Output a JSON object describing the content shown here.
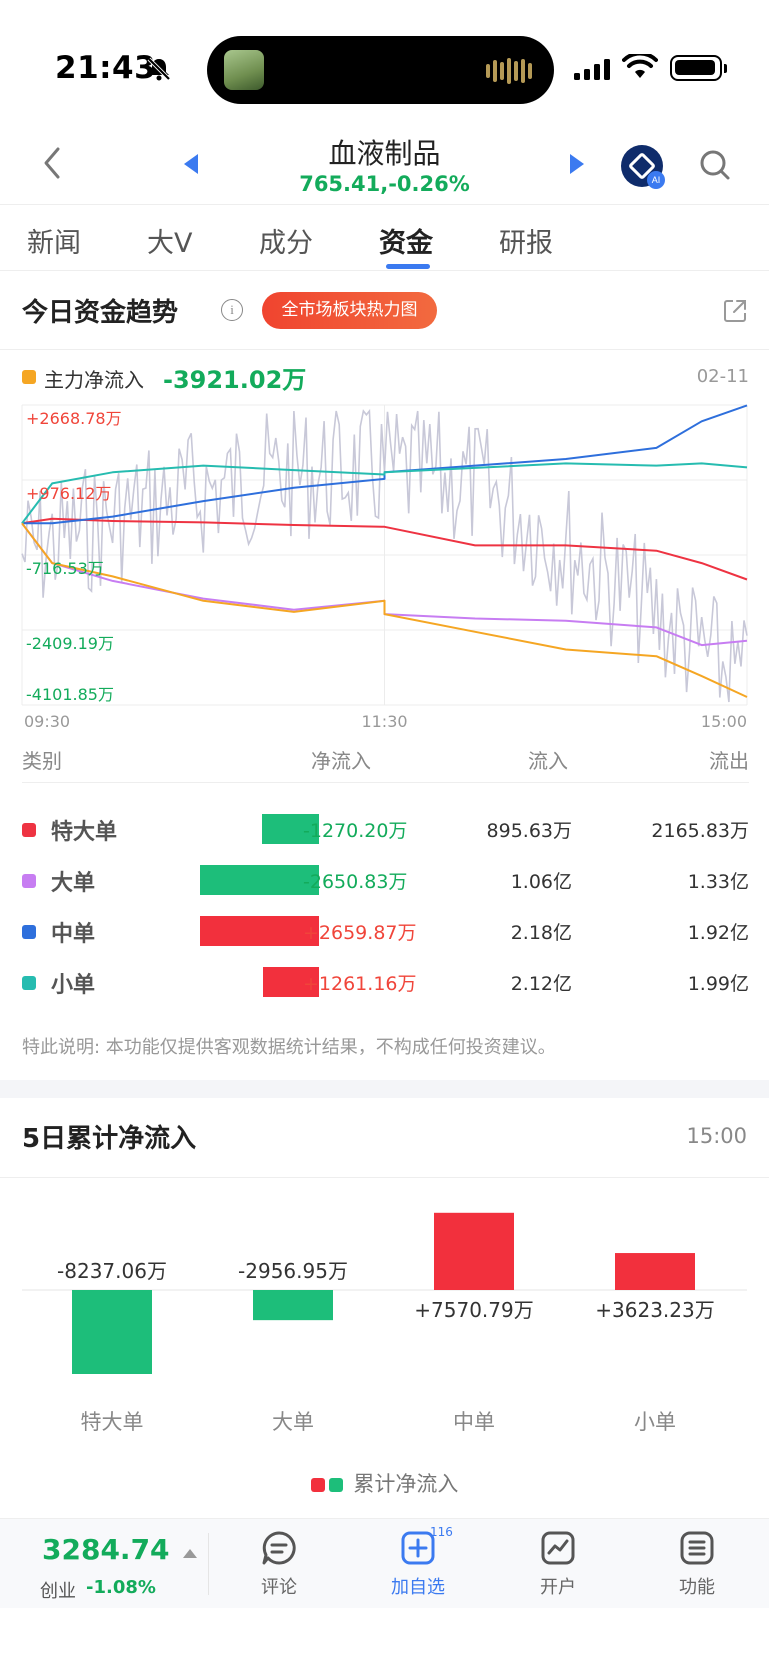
{
  "status_bar": {
    "time": "21:43"
  },
  "header": {
    "title": "血液制品",
    "subtitle": "765.41,-0.26%"
  },
  "tabs": [
    {
      "label": "新闻",
      "active": false
    },
    {
      "label": "大V",
      "active": false
    },
    {
      "label": "成分",
      "active": false
    },
    {
      "label": "资金",
      "active": true
    },
    {
      "label": "研报",
      "active": false
    }
  ],
  "fund_trend": {
    "title": "今日资金趋势",
    "heatmap_button": "全市场板块热力图",
    "legend_label": "主力净流入",
    "legend_value": "-3921.02万",
    "date": "02-11"
  },
  "chart_data": {
    "type": "line",
    "y_ticks": [
      "+2668.78万",
      "+976.12万",
      "-716.53万",
      "-2409.19万",
      "-4101.85万"
    ],
    "x_ticks": [
      "09:30",
      "11:30",
      "15:00"
    ],
    "ylim": [
      -4101.85,
      2668.78
    ],
    "colors": {
      "super_large": "#ee3342",
      "large": "#c77df2",
      "medium": "#2e6fdc",
      "small": "#26bcb0",
      "main": "#f5a623",
      "stock": "#c8c8d8"
    },
    "series": [
      {
        "name": "特大单",
        "key": "super_large",
        "x": [
          "09:30",
          "09:40",
          "10:00",
          "10:30",
          "11:00",
          "11:30",
          "13:00",
          "13:30",
          "14:00",
          "14:30",
          "14:45",
          "15:00"
        ],
        "values": [
          0,
          100,
          50,
          20,
          -40,
          -80,
          -80,
          -500,
          -500,
          -620,
          -900,
          -1270.2
        ]
      },
      {
        "name": "大单",
        "key": "large",
        "x": [
          "09:30",
          "09:40",
          "10:00",
          "10:30",
          "11:00",
          "11:30",
          "13:00",
          "13:30",
          "14:00",
          "14:30",
          "14:45",
          "15:00"
        ],
        "values": [
          0,
          -900,
          -1300,
          -1700,
          -1950,
          -1750,
          -2050,
          -2150,
          -2200,
          -2350,
          -2750,
          -2650.83
        ]
      },
      {
        "name": "中单",
        "key": "medium",
        "x": [
          "09:30",
          "09:40",
          "10:00",
          "10:30",
          "11:00",
          "11:30",
          "13:00",
          "13:30",
          "14:00",
          "14:30",
          "14:45",
          "15:00"
        ],
        "values": [
          0,
          0,
          150,
          500,
          800,
          1000,
          1150,
          1300,
          1450,
          1700,
          2300,
          2659.87
        ]
      },
      {
        "name": "小单",
        "key": "small",
        "x": [
          "09:30",
          "09:40",
          "10:00",
          "10:30",
          "11:00",
          "11:30",
          "13:00",
          "13:30",
          "14:00",
          "14:30",
          "14:45",
          "15:00"
        ],
        "values": [
          0,
          900,
          1150,
          1300,
          1200,
          1100,
          1150,
          1250,
          1350,
          1300,
          1350,
          1261.16
        ]
      },
      {
        "name": "主力净流入",
        "key": "main",
        "x": [
          "09:30",
          "09:40",
          "10:00",
          "10:30",
          "11:00",
          "11:30",
          "13:00",
          "13:30",
          "14:00",
          "14:30",
          "14:45",
          "15:00"
        ],
        "values": [
          0,
          -900,
          -1200,
          -1750,
          -2000,
          -1750,
          -2050,
          -2450,
          -2850,
          -3000,
          -3450,
          -3921.02
        ]
      }
    ]
  },
  "table": {
    "headers": {
      "category": "类别",
      "net": "净流入",
      "inflow": "流入",
      "outflow": "流出"
    },
    "rows": [
      {
        "name": "特大单",
        "color": "#ee3342",
        "net": "-1270.20万",
        "net_value": -1270.2,
        "inflow": "895.63万",
        "outflow": "2165.83万"
      },
      {
        "name": "大单",
        "color": "#c77df2",
        "net": "-2650.83万",
        "net_value": -2650.83,
        "inflow": "1.06亿",
        "outflow": "1.33亿"
      },
      {
        "name": "中单",
        "color": "#2e6fdc",
        "net": "+2659.87万",
        "net_value": 2659.87,
        "inflow": "2.18亿",
        "outflow": "1.92亿"
      },
      {
        "name": "小单",
        "color": "#26bcb0",
        "net": "+1261.16万",
        "net_value": 1261.16,
        "inflow": "2.12亿",
        "outflow": "1.99亿"
      }
    ],
    "note": "特此说明: 本功能仅提供客观数据统计结果，不构成任何投资建议。"
  },
  "five_day": {
    "title": "5日累计净流入",
    "time": "15:00",
    "legend": "累计净流入",
    "chart_data": {
      "type": "bar",
      "categories": [
        "特大单",
        "大单",
        "中单",
        "小单"
      ],
      "values": [
        -8237.06,
        -2956.95,
        7570.79,
        3623.23
      ],
      "labels": [
        "-8237.06万",
        "-2956.95万",
        "+7570.79万",
        "+3623.23万"
      ]
    }
  },
  "colors": {
    "up": "#f2303d",
    "down": "#1dbe7a",
    "accent": "#3b7af0"
  },
  "bottom_bar": {
    "index_value": "3284.74",
    "index_name": "创业",
    "index_change": "-1.08%",
    "items": [
      {
        "label": "评论",
        "icon": "comment-icon"
      },
      {
        "label": "加自选",
        "icon": "add-watchlist-icon",
        "badge": "116"
      },
      {
        "label": "开户",
        "icon": "open-account-icon"
      },
      {
        "label": "功能",
        "icon": "menu-icon"
      }
    ]
  }
}
